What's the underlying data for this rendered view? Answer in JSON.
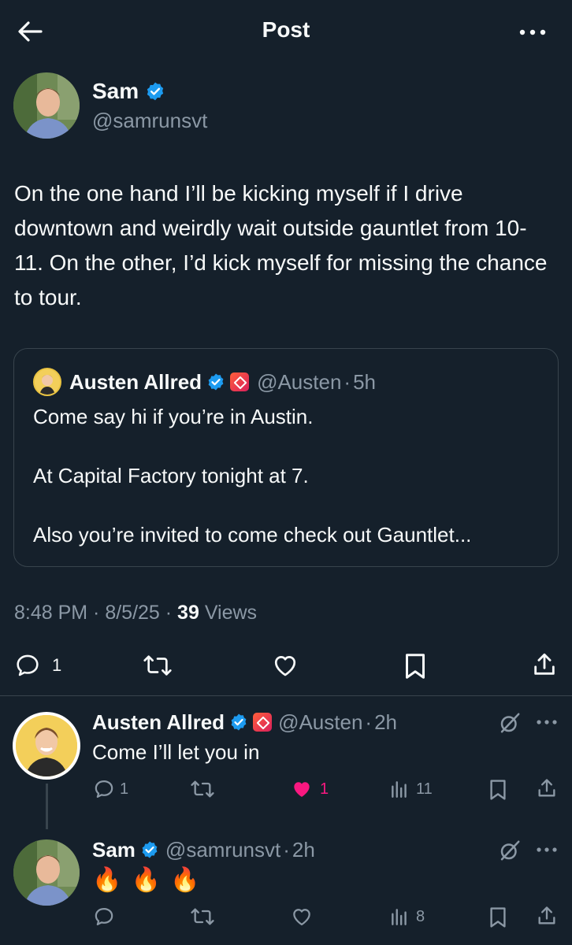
{
  "header": {
    "title": "Post"
  },
  "post": {
    "author_name": "Sam",
    "author_handle": "@samrunsvt",
    "text": "On the one hand I’ll be kicking myself if I drive downtown and weirdly wait outside gauntlet from 10-11. On the other, I’d kick myself for missing the chance to tour.",
    "quote": {
      "author_name": "Austen Allred",
      "author_handle": "@Austen",
      "time": "5h",
      "lines": [
        "Come say hi if you’re in Austin.",
        "At Capital Factory tonight at 7.",
        "Also you’re invited to come check out Gauntlet..."
      ]
    },
    "timestamp": "8:48 PM · 8/5/25 · ",
    "views_count": "39",
    "views_label": "Views",
    "reply_count": "1"
  },
  "replies": [
    {
      "author_name": "Austen Allred",
      "author_handle": "@Austen",
      "time": "2h",
      "text": "Come I’ll let you in",
      "reply_count": "1",
      "like_count": "1",
      "view_count": "11"
    },
    {
      "author_name": "Sam",
      "author_handle": "@samrunsvt",
      "time": "2h",
      "text": "🔥 🔥 🔥",
      "view_count": "8"
    }
  ],
  "colors": {
    "background": "#15202b",
    "verified": "#1d9bf0",
    "like": "#f91880",
    "muted": "#8b98a5"
  },
  "icons": [
    "back-arrow-icon",
    "more-icon",
    "verified-icon",
    "reply-icon",
    "retweet-icon",
    "like-icon",
    "bookmark-icon",
    "share-icon",
    "views-icon",
    "grok-icon"
  ]
}
